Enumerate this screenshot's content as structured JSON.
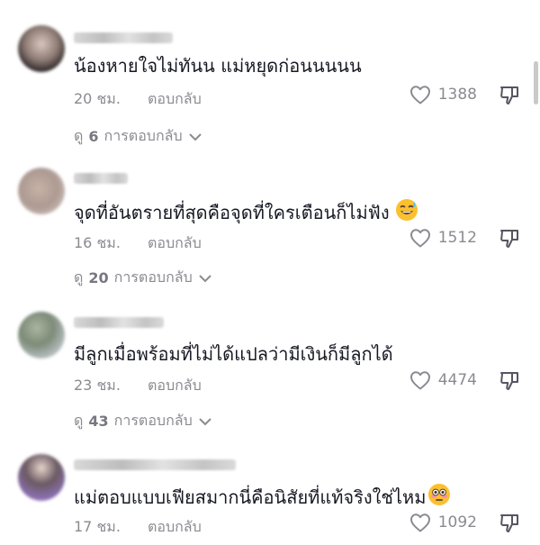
{
  "comments": [
    {
      "text": "น้องหายใจไม่ทันน แม่หยุดก่อนนนนน",
      "emoji": "",
      "time": "20 ชม.",
      "reply_label": "ตอบกลับ",
      "likes": "1388",
      "view_replies": {
        "prefix": "ดู",
        "count": "6",
        "suffix": "การตอบกลับ"
      }
    },
    {
      "text": "จุดที่อันตรายที่สุดคือจุดที่ใครเตือนก็ไม่ฟัง",
      "emoji": "sweat-smile-emoji",
      "time": "16 ชม.",
      "reply_label": "ตอบกลับ",
      "likes": "1512",
      "view_replies": {
        "prefix": "ดู",
        "count": "20",
        "suffix": "การตอบกลับ"
      }
    },
    {
      "text": "มีลูกเมื่อพร้อมที่ไม่ได้แปลว่ามีเงินก็มีลูกได้",
      "emoji": "",
      "time": "23 ชม.",
      "reply_label": "ตอบกลับ",
      "likes": "4474",
      "view_replies": {
        "prefix": "ดู",
        "count": "43",
        "suffix": "การตอบกลับ"
      }
    },
    {
      "text": "แม่ตอบแบบเฟียสมากนี่คือนิสัยที่แท้จริงใช่ไหม",
      "emoji": "flushed-emoji",
      "time": "17 ชม.",
      "reply_label": "ตอบกลับ",
      "likes": "1092"
    }
  ],
  "icons": {
    "like": "heart-outline-icon",
    "dislike": "thumbs-down-outline-icon",
    "expand": "chevron-down-icon"
  },
  "colors": {
    "text": "#161823",
    "muted": "#8a8b91"
  }
}
